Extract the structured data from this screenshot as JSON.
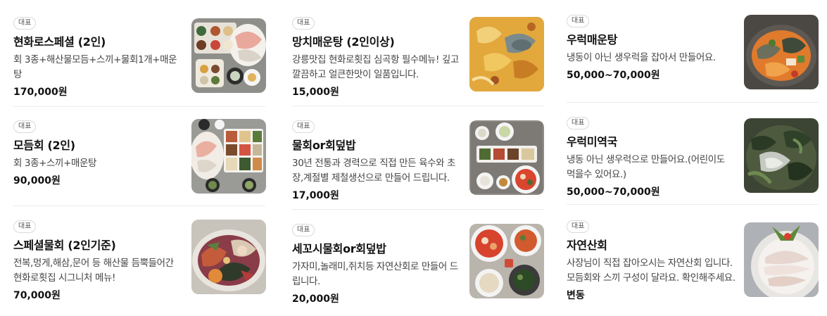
{
  "columns": [
    {
      "items": [
        {
          "badge": "대표",
          "name": "현화로스페셜 (2인)",
          "description": "회 3종+해산물모듬+스끼+물회1개+매운탕",
          "price": "170,000원",
          "photo_icon": "sashimi-platter-photo"
        },
        {
          "badge": "대표",
          "name": "모듬회 (2인)",
          "description": "회 3종+스끼+매운탕",
          "price": "90,000원",
          "photo_icon": "sashimi-set-photo"
        },
        {
          "badge": "대표",
          "name": "스페셜물회 (2인기준)",
          "description": "전복,멍게,해삼,문어 등 해산물 듬뿍들어간 현화로횟집 시그니처 메뉴!",
          "price": "70,000원",
          "photo_icon": "special-mulhoe-photo"
        }
      ]
    },
    {
      "items": [
        {
          "badge": "대표",
          "name": "망치매운탕 (2인이상)",
          "description": "강릉맛집 현화로횟집 심곡항 필수메뉴! 깊고 깔끔하고 얼큰한맛이 일품입니다.",
          "price": "15,000원",
          "photo_icon": "spicy-fish-stew-photo"
        },
        {
          "badge": "대표",
          "name": "물회or회덮밥",
          "description": "30년 전통과 경력으로 직접 만든 육수와 초장,계절별 제철생선으로 만들어 드립니다.",
          "price": "17,000원",
          "photo_icon": "mulhoe-meal-photo"
        },
        {
          "badge": "대표",
          "name": "세꼬시물회or회덮밥",
          "description": "가자미,놀래미,쥐치등 자연산회로 만들어 드립니다.",
          "price": "20,000원",
          "photo_icon": "sekkoshi-mulhoe-photo"
        }
      ]
    },
    {
      "items": [
        {
          "badge": "대표",
          "name": "우럭매운탕",
          "description": "냉동이 아닌 생우럭을 잡아서 만들어요.",
          "price": "50,000~70,000원",
          "photo_icon": "rockfish-stew-photo"
        },
        {
          "badge": "대표",
          "name": "우럭미역국",
          "description": "냉동 아닌 생우럭으로 만들어요.(어린이도 먹을수 있어요.)",
          "price": "50,000~70,000원",
          "photo_icon": "rockfish-seaweed-soup-photo"
        },
        {
          "badge": "대표",
          "name": "자연산회",
          "description": "사장님이 직접 잡아오시는 자연산회 입니다. 모듬회와 스끼 구성이 달라요. 확인해주세요.",
          "price": "변동",
          "photo_icon": "wild-sashimi-photo"
        }
      ]
    }
  ],
  "colors": {
    "text": "#111111",
    "description": "#444444",
    "badge_border": "#d9d9d9",
    "divider": "#ececec"
  }
}
